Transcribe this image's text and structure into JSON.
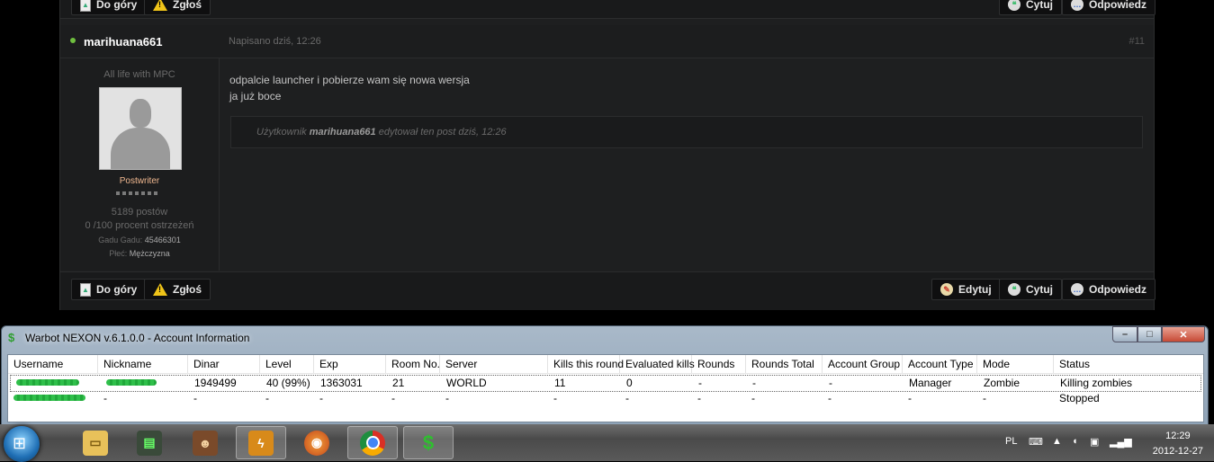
{
  "forum": {
    "top_buttons": {
      "to_top": "Do góry",
      "report": "Zgłoś",
      "quote": "Cytuj",
      "reply": "Odpowiedz"
    },
    "post": {
      "author": "marihuana661",
      "posted": "Napisano dziś, 12:26",
      "number": "#11",
      "motto": "All life with MPC",
      "rank": "Postwriter",
      "posts": "5189 postów",
      "warnings": "0 /100 procent ostrzeżeń",
      "gadu_label": "Gadu Gadu:",
      "gadu_value": "45466301",
      "gender_label": "Płeć:",
      "gender_value": "Mężczyzna",
      "lines": [
        "odpalcie launcher i pobierze wam się nowa wersja",
        "ja już boce"
      ],
      "edit_prefix": "Użytkownik",
      "edit_user": "marihuana661",
      "edit_suffix": "edytował ten post dziś, 12:26"
    },
    "bottom_buttons": {
      "to_top": "Do góry",
      "report": "Zgłoś",
      "edit": "Edytuj",
      "quote": "Cytuj",
      "reply": "Odpowiedz"
    }
  },
  "window": {
    "title": "Warbot NEXON v.6.1.0.0 - Account Information",
    "columns": [
      "Username",
      "Nickname",
      "Dinar",
      "Level",
      "Exp",
      "Room No.",
      "Server",
      "Kills this round",
      "Evaluated kills",
      "Rounds",
      "Rounds Total",
      "Account Group",
      "Account Type",
      "Mode",
      "Status"
    ],
    "rows": [
      [
        "",
        "",
        "1949499",
        "40 (99%)",
        "1363031",
        "21",
        "WORLD",
        "11",
        "0",
        "-",
        "-",
        "-",
        "Manager",
        "Zombie",
        "Killing zombies"
      ],
      [
        "",
        "-",
        "-",
        "-",
        "-",
        "-",
        "-",
        "-",
        "-",
        "-",
        "-",
        "-",
        "-",
        "-",
        "Stopped"
      ]
    ]
  },
  "taskbar": {
    "items": [
      "explorer-icon",
      "task-manager-icon",
      "game-icon",
      "winamp-icon",
      "firefox-icon",
      "chrome-icon",
      "warbot-icon"
    ],
    "lang": "PL",
    "time": "12:29",
    "date": "2012-12-27"
  }
}
